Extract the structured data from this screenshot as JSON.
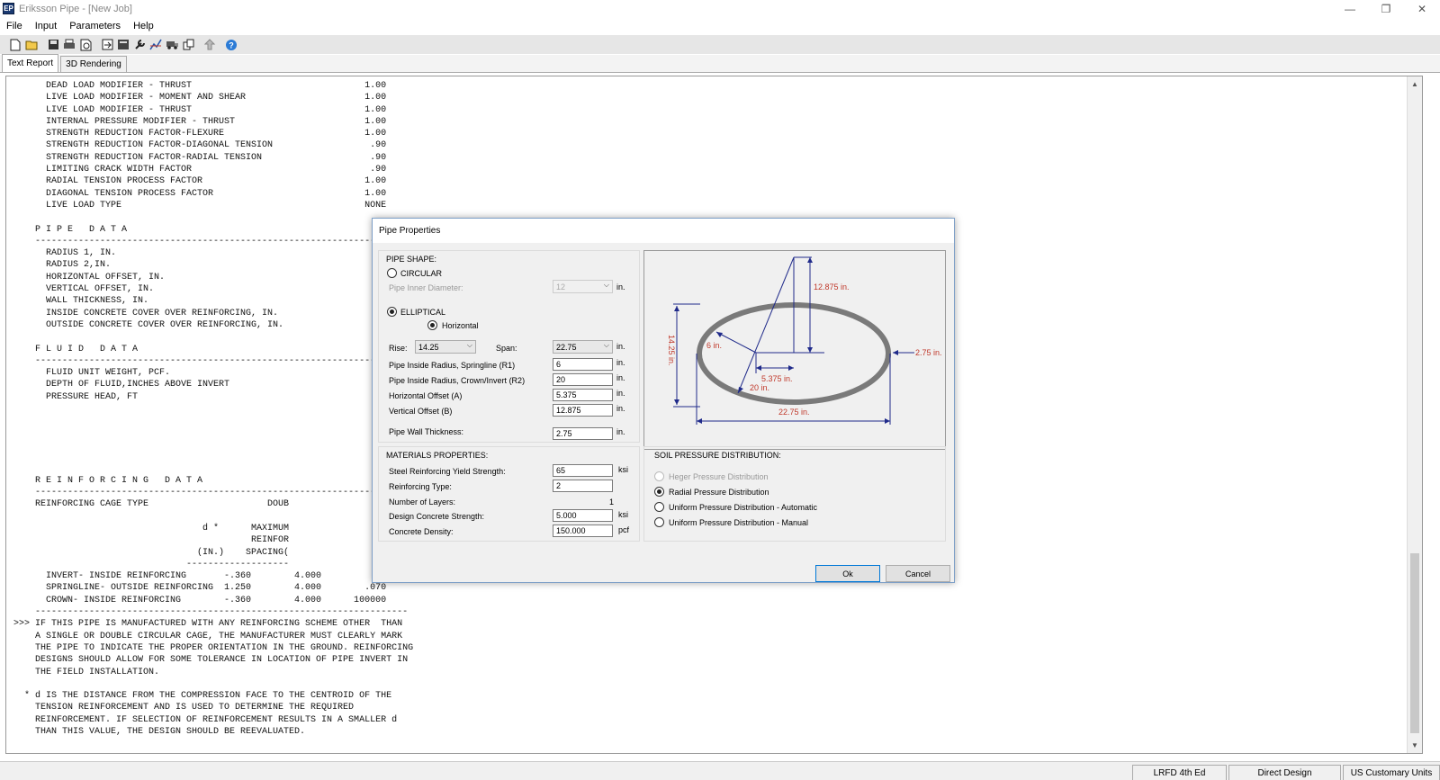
{
  "window": {
    "title": "Eriksson Pipe - [New Job]",
    "icon_label": "EP",
    "minimize": "—",
    "restore": "❐",
    "close": "✕"
  },
  "menu": [
    "File",
    "Input",
    "Parameters",
    "Help"
  ],
  "toolbar_icons": [
    "new-icon",
    "open-icon",
    "save-icon",
    "print-icon",
    "print-preview-icon",
    "export-icon",
    "calculator-icon",
    "wrench-icon",
    "chart-icon",
    "truck-icon",
    "copy-icon",
    "arrow-icon",
    "help-icon"
  ],
  "tabs": [
    "Text Report",
    "3D Rendering"
  ],
  "report_lines": [
    "      DEAD LOAD MODIFIER - THRUST                                1.00",
    "      LIVE LOAD MODIFIER - MOMENT AND SHEAR                      1.00",
    "      LIVE LOAD MODIFIER - THRUST                                1.00",
    "      INTERNAL PRESSURE MODIFIER - THRUST                        1.00",
    "      STRENGTH REDUCTION FACTOR-FLEXURE                          1.00",
    "      STRENGTH REDUCTION FACTOR-DIAGONAL TENSION                  .90",
    "      STRENGTH REDUCTION FACTOR-RADIAL TENSION                    .90",
    "      LIMITING CRACK WIDTH FACTOR                                 .90",
    "      RADIAL TENSION PROCESS FACTOR                              1.00",
    "      DIAGONAL TENSION PROCESS FACTOR                            1.00",
    "      LIVE LOAD TYPE                                             NONE",
    "",
    "    P I P E   D A T A",
    "    ---------------------------------------------------------------",
    "      RADIUS 1, IN.",
    "      RADIUS 2,IN.",
    "      HORIZONTAL OFFSET, IN.",
    "      VERTICAL OFFSET, IN.",
    "      WALL THICKNESS, IN.",
    "      INSIDE CONCRETE COVER OVER REINFORCING, IN.",
    "      OUTSIDE CONCRETE COVER OVER REINFORCING, IN.",
    "",
    "    F L U I D   D A T A",
    "    ---------------------------------------------------------------",
    "      FLUID UNIT WEIGHT, PCF.",
    "      DEPTH OF FLUID,INCHES ABOVE INVERT",
    "      PRESSURE HEAD, FT",
    "",
    "",
    "",
    "",
    "",
    "",
    "    R E I N F O R C I N G   D A T A",
    "    ---------------------------------------------------------------",
    "    REINFORCING CAGE TYPE                      DOUB",
    "",
    "                                   d *      MAXIMUM",
    "                                            REINFOR",
    "                                  (IN.)    SPACING(",
    "                                -------------------",
    "      INVERT- INSIDE REINFORCING       -.360        4.000",
    "      SPRINGLINE- OUTSIDE REINFORCING  1.250        4.000        .070",
    "      CROWN- INSIDE REINFORCING        -.360        4.000      100000",
    "    ---------------------------------------------------------------------",
    ">>> IF THIS PIPE IS MANUFACTURED WITH ANY REINFORCING SCHEME OTHER  THAN",
    "    A SINGLE OR DOUBLE CIRCULAR CAGE, THE MANUFACTURER MUST CLEARLY MARK",
    "    THE PIPE TO INDICATE THE PROPER ORIENTATION IN THE GROUND. REINFORCING",
    "    DESIGNS SHOULD ALLOW FOR SOME TOLERANCE IN LOCATION OF PIPE INVERT IN",
    "    THE FIELD INSTALLATION.",
    "",
    "  * d IS THE DISTANCE FROM THE COMPRESSION FACE TO THE CENTROID OF THE",
    "    TENSION REINFORCEMENT AND IS USED TO DETERMINE THE REQUIRED",
    "    REINFORCEMENT. IF SELECTION OF REINFORCEMENT RESULTS IN A SMALLER d",
    "    THAN THIS VALUE, THE DESIGN SHOULD BE REEVALUATED."
  ],
  "status": [
    "LRFD 4th Ed",
    "Direct Design",
    "US Customary Units"
  ],
  "dialog": {
    "title": "Pipe Properties",
    "pipe_shape_label": "PIPE SHAPE:",
    "circular_label": "CIRCULAR",
    "inner_diameter_label": "Pipe Inner Diameter:",
    "inner_diameter_value": "12",
    "elliptical_label": "ELLIPTICAL",
    "horizontal_label": "Horizontal",
    "rise_label": "Rise:",
    "rise_value": "14.25",
    "span_label": "Span:",
    "span_value": "22.75",
    "unit_in": "in.",
    "r1_label": "Pipe Inside Radius, Springline (R1)",
    "r1_value": "6",
    "r2_label": "Pipe Inside Radius, Crown/Invert (R2)",
    "r2_value": "20",
    "a_label": "Horizontal Offset (A)",
    "a_value": "5.375",
    "b_label": "Vertical Offset (B)",
    "b_value": "12.875",
    "wall_label": "Pipe Wall Thickness:",
    "wall_value": "2.75",
    "materials_label": "MATERIALS PROPERTIES:",
    "steel_label": "Steel Reinforcing Yield Strength:",
    "steel_value": "65",
    "unit_ksi": "ksi",
    "rtype_label": "Reinforcing Type:",
    "rtype_value": "2",
    "layers_label": "Number of Layers:",
    "layers_value": "1",
    "concrete_label": "Design Concrete Strength:",
    "concrete_value": "5.000",
    "density_label": "Concrete Density:",
    "density_value": "150.000",
    "unit_pcf": "pcf",
    "soil_label": "SOIL PRESSURE DISTRIBUTION:",
    "heger_label": "Heger Pressure Distribution",
    "radial_label": "Radial Pressure Distribution",
    "uniform_auto_label": "Uniform Pressure Distribution - Automatic",
    "uniform_manual_label": "Uniform Pressure Distribution - Manual",
    "ok_label": "Ok",
    "cancel_label": "Cancel",
    "diagram": {
      "b_dim": "12.875 in.",
      "r1_dim": "6 in.",
      "a_dim": "5.375 in.",
      "r2_dim": "20 in.",
      "rise_dim": "14.25 in.",
      "span_dim": "22.75 in.",
      "wall_dim": "2.75 in.",
      "dim_color": "#c0392b",
      "line_color": "#1f2a8a",
      "pipe_color": "#7a7a7a"
    }
  }
}
